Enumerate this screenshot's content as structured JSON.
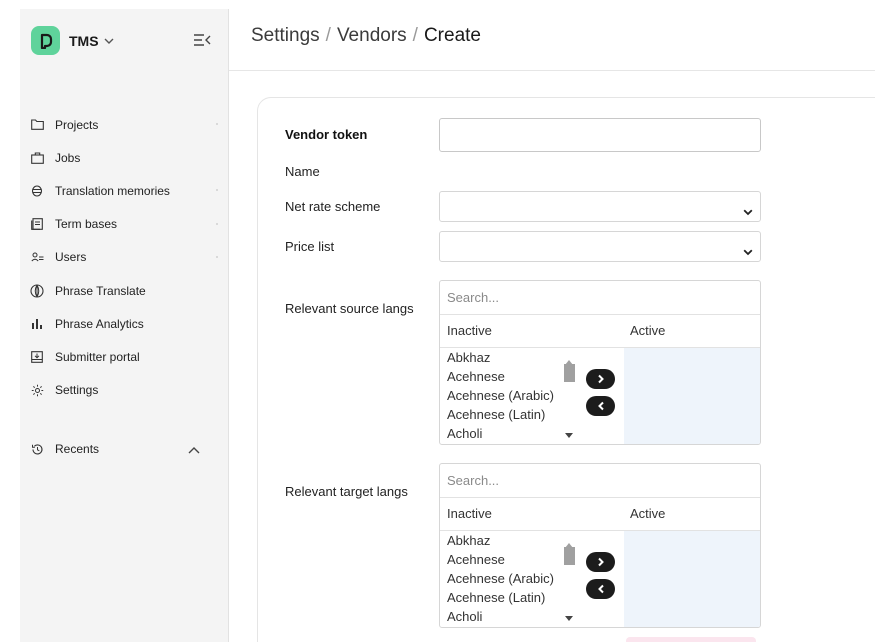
{
  "brand": {
    "name": "TMS"
  },
  "sidebar": {
    "items": [
      {
        "label": "Projects",
        "icon": "folder-icon"
      },
      {
        "label": "Jobs",
        "icon": "briefcase-icon"
      },
      {
        "label": "Translation memories",
        "icon": "database-icon"
      },
      {
        "label": "Term bases",
        "icon": "book-icon"
      },
      {
        "label": "Users",
        "icon": "users-icon"
      },
      {
        "label": "Phrase Translate",
        "icon": "globe-icon"
      },
      {
        "label": "Phrase Analytics",
        "icon": "bar-chart-icon"
      },
      {
        "label": "Submitter portal",
        "icon": "inbox-icon"
      },
      {
        "label": "Settings",
        "icon": "gear-icon"
      }
    ],
    "recents": {
      "label": "Recents",
      "icon": "history-icon"
    }
  },
  "breadcrumb": {
    "part1": "Settings",
    "part2": "Vendors",
    "part3": "Create",
    "separator": "/"
  },
  "form": {
    "vendor_token": {
      "label": "Vendor token",
      "value": ""
    },
    "name": {
      "label": "Name"
    },
    "net_rate_scheme": {
      "label": "Net rate scheme",
      "value": ""
    },
    "price_list": {
      "label": "Price list",
      "value": ""
    },
    "source_langs": {
      "label": "Relevant source langs",
      "search_placeholder": "Search...",
      "inactive_header": "Inactive",
      "active_header": "Active",
      "inactive_items": [
        "Abkhaz",
        "Acehnese",
        "Acehnese (Arabic)",
        "Acehnese (Latin)",
        "Acholi"
      ],
      "active_items": []
    },
    "target_langs": {
      "label": "Relevant target langs",
      "search_placeholder": "Search...",
      "inactive_header": "Inactive",
      "active_header": "Active",
      "inactive_items": [
        "Abkhaz",
        "Acehnese",
        "Acehnese (Arabic)",
        "Acehnese (Latin)",
        "Acholi"
      ],
      "active_items": []
    }
  },
  "colors": {
    "brand": "#5fd39b",
    "sidebar_bg": "#f4f4f4",
    "active_list_bg": "#eef4fb",
    "transfer_button": "#1c1c1c"
  }
}
